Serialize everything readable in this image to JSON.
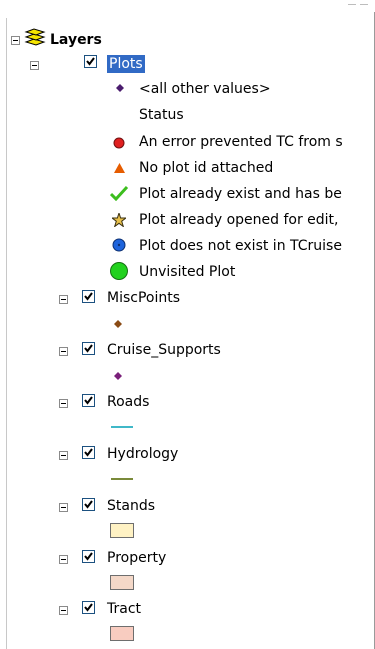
{
  "toc": {
    "root_label": "Layers",
    "plots": {
      "label": "Plots",
      "legend": [
        {
          "symbol": "diamond-icon",
          "color": "#4b1c6e",
          "label": "<all other values>"
        },
        {
          "symbol": "none",
          "color": "",
          "label": "Status"
        },
        {
          "symbol": "red-circle-icon",
          "color": "#e02020",
          "label": "An error prevented TC from s"
        },
        {
          "symbol": "orange-triangle-icon",
          "color": "#e65c00",
          "label": "No plot id attached"
        },
        {
          "symbol": "green-check-icon",
          "color": "#3cbe1e",
          "label": "Plot already exist and has be"
        },
        {
          "symbol": "star-icon",
          "color": "#a38a2a",
          "label": "Plot already opened for edit,"
        },
        {
          "symbol": "blue-circle-icon",
          "color": "#1e64dc",
          "label": "Plot does not exist in TCruise"
        },
        {
          "symbol": "green-circle-icon",
          "color": "#22d11e",
          "label": "Unvisited Plot"
        }
      ]
    },
    "layers": [
      {
        "label": "MiscPoints",
        "symbol": "diamond-icon",
        "color": "#8a4b14"
      },
      {
        "label": "Cruise_Supports",
        "symbol": "diamond-icon",
        "color": "#7a1f7a"
      },
      {
        "label": "Roads",
        "symbol": "line-icon",
        "color": "#40b8c8"
      },
      {
        "label": "Hydrology",
        "symbol": "line-icon",
        "color": "#7a8a3a"
      },
      {
        "label": "Stands",
        "symbol": "polygon-icon",
        "color": "#fff2c4"
      },
      {
        "label": "Property",
        "symbol": "polygon-icon",
        "color": "#f4d8c8"
      },
      {
        "label": "Tract",
        "symbol": "polygon-icon",
        "color": "#f8ccc0"
      }
    ]
  }
}
